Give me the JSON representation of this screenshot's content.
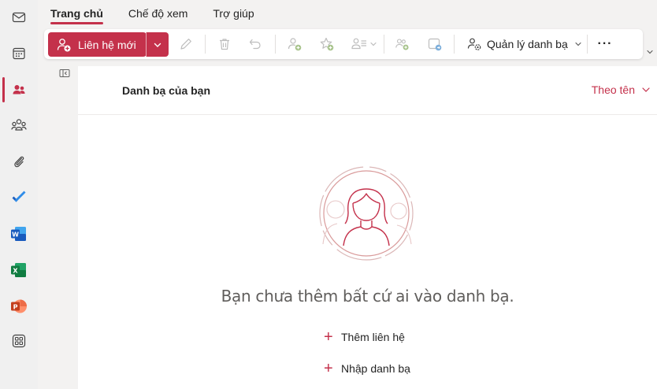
{
  "tabs": [
    {
      "label": "Trang chủ",
      "active": true
    },
    {
      "label": "Chế độ xem",
      "active": false
    },
    {
      "label": "Trợ giúp",
      "active": false
    }
  ],
  "ribbon": {
    "new_contact_label": "Liên hệ mới",
    "manage_label": "Quản lý danh bạ",
    "more_label": "···"
  },
  "list_header": {
    "title": "Danh bạ của bạn",
    "sort_label": "Theo tên"
  },
  "empty_state": {
    "message": "Bạn chưa thêm bất cứ ai vào danh bạ.",
    "actions": [
      {
        "label": "Thêm liên hệ"
      },
      {
        "label": "Nhập danh bạ"
      }
    ]
  },
  "colors": {
    "accent": "#c4314b",
    "rail_bg": "#f0f0f0",
    "page_bg": "#f3f2f1"
  },
  "rail_icons": [
    "mail-icon",
    "calendar-icon",
    "people-icon",
    "groups-icon",
    "attachment-icon",
    "todo-icon",
    "word-icon",
    "excel-icon",
    "powerpoint-icon",
    "apps-icon"
  ]
}
